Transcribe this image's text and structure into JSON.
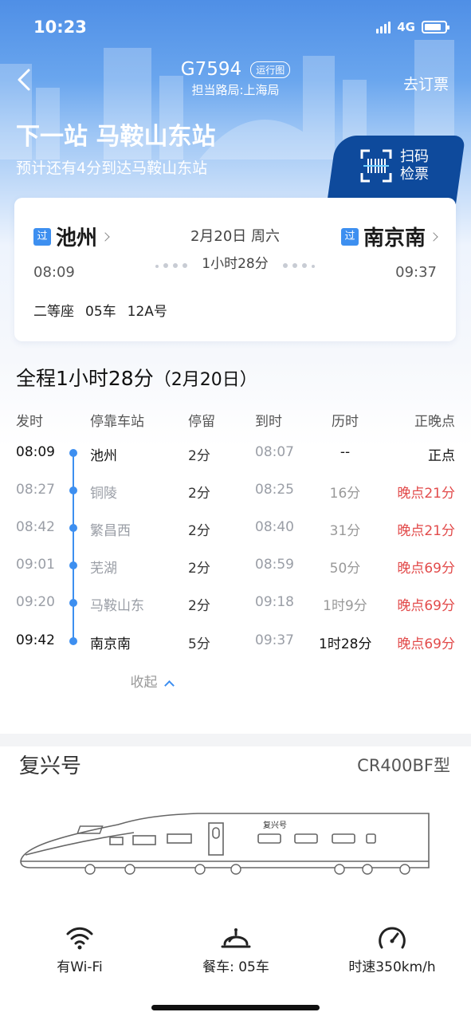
{
  "status_bar": {
    "time": "10:23",
    "network": "4G"
  },
  "nav": {
    "train_no": "G7594",
    "run_chart_label": "运行图",
    "bureau": "担当路局:上海局",
    "buy_ticket": "去订票"
  },
  "next": {
    "headline": "下一站 马鞍山东站",
    "eta": "预计还有4分到达马鞍山东站"
  },
  "scan": {
    "line1": "扫码",
    "line2": "检票"
  },
  "trip": {
    "pass_badge": "过",
    "from_name": "池州",
    "from_time": "08:09",
    "to_name": "南京南",
    "to_time": "09:37",
    "date": "2月20日 周六",
    "duration": "1小时28分",
    "seat_class": "二等座",
    "coach": "05车",
    "seat_no": "12A号"
  },
  "schedule": {
    "title": "全程1小时28分",
    "title_date": "（2月20日）",
    "headers": [
      "发时",
      "停靠车站",
      "停留",
      "到时",
      "历时",
      "正晚点"
    ],
    "rows": [
      {
        "depart": "08:09",
        "station": "池州",
        "stay": "2分",
        "arrive": "08:07",
        "elapsed": "--",
        "status": "正点",
        "late": false,
        "emph": true
      },
      {
        "depart": "08:27",
        "station": "铜陵",
        "stay": "2分",
        "arrive": "08:25",
        "elapsed": "16分",
        "status": "晚点21分",
        "late": true,
        "emph": false
      },
      {
        "depart": "08:42",
        "station": "繁昌西",
        "stay": "2分",
        "arrive": "08:40",
        "elapsed": "31分",
        "status": "晚点21分",
        "late": true,
        "emph": false
      },
      {
        "depart": "09:01",
        "station": "芜湖",
        "stay": "2分",
        "arrive": "08:59",
        "elapsed": "50分",
        "status": "晚点69分",
        "late": true,
        "emph": false
      },
      {
        "depart": "09:20",
        "station": "马鞍山东",
        "stay": "2分",
        "arrive": "09:18",
        "elapsed": "1时9分",
        "status": "晚点69分",
        "late": true,
        "emph": false
      },
      {
        "depart": "09:42",
        "station": "南京南",
        "stay": "5分",
        "arrive": "09:37",
        "elapsed": "1时28分",
        "status": "晚点69分",
        "late": true,
        "emph": true
      }
    ],
    "collapse_label": "收起"
  },
  "train_model": {
    "name": "复兴号",
    "type": "CR400BF型",
    "livery_text": "复兴号"
  },
  "features": {
    "wifi": "有Wi-Fi",
    "dining": "餐车: 05车",
    "speed": "时速350km/h"
  },
  "colors": {
    "accent": "#3d8ff0",
    "late": "#e24b4b",
    "scan_bg": "#0e4a9c"
  }
}
